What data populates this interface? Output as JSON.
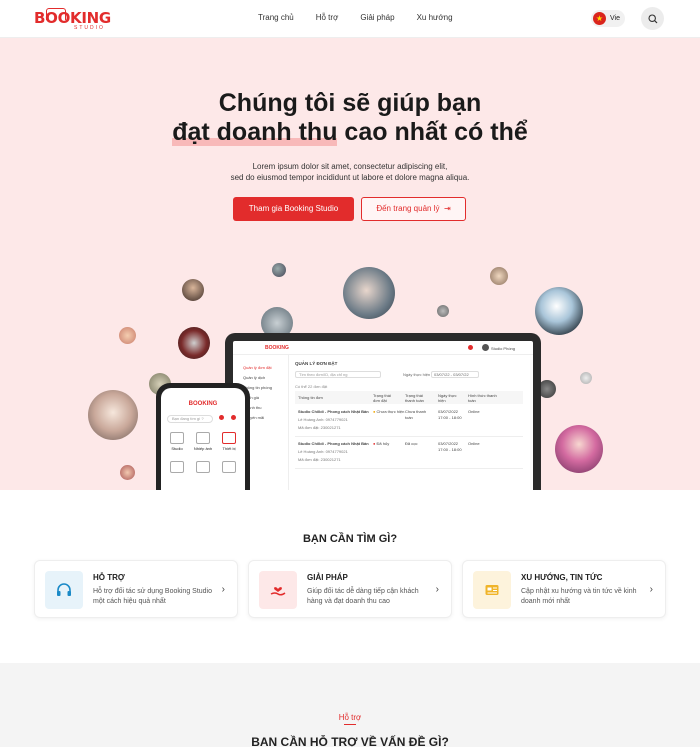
{
  "header": {
    "logo_text": "BOOKING",
    "logo_sub": "STUDIO",
    "nav": [
      "Trang chủ",
      "Hỗ trợ",
      "Giải pháp",
      "Xu hướng"
    ],
    "lang_label": "Vie"
  },
  "hero": {
    "title_line1": "Chúng tôi sẽ giúp bạn",
    "title_hl": "đạt doanh thu",
    "title_rest": " cao nhất có thể",
    "desc_line1": "Lorem ipsum dolor sit amet, consectetur adipiscing elit,",
    "desc_line2": "sed do eiusmod tempor incididunt ut labore et dolore magna aliqua.",
    "btn_primary": "Tham gia Booking Studio",
    "btn_outline": "Đến trang quản lý"
  },
  "laptop": {
    "logo": "BOOKING",
    "user": "Studio Phóng",
    "sidebar": [
      "Quản lý đơn đặt",
      "Quản lý dịch",
      "Thông tin phòng",
      "Đánh giá",
      "Doanh thu",
      "Khuyến mãi"
    ],
    "page_title": "QUẢN LÝ ĐƠN ĐẶT",
    "search_placeholder": "Tìm theo đơn/ID, địa chỉ ng",
    "date_label": "Ngày thực hiện",
    "date_value": "03/07/22 - 03/07/22",
    "count_label": "Có thể 22 đơn đặt",
    "columns": [
      "Thông tin đơn",
      "Trạng thái đơn đặt",
      "Trạng thái thanh toán",
      "Ngày thực hiện",
      "Hình thức thanh toán"
    ],
    "rows": [
      {
        "name": "Studio Chilldi - Phong cách Nhật Bản",
        "customer": "Lê Hoàng Anh: 0974779021",
        "id": "Mã đơn đặt: 230021271",
        "status": "Chưa thực hiện",
        "payment": "Chưa thanh toán",
        "date": "03/07/2022 17:00 - 18:00",
        "method": "Online"
      },
      {
        "name": "Studio Chilldi - Phong cách Nhật Bản",
        "customer": "Lê Hoàng Anh: 0974779021",
        "id": "Mã đơn đặt: 230021271",
        "status": "Đã hủy",
        "payment": "Đã cọc",
        "date": "03/07/2022 17:00 - 18:00",
        "method": "Online"
      }
    ]
  },
  "phone": {
    "logo": "BOOKING",
    "search_placeholder": "Bạn đang tìm gì ?",
    "categories": [
      "Studio",
      "Nhiếp ảnh",
      "Thiết bị"
    ]
  },
  "find": {
    "title": "BẠN CẦN TÌM GÌ?",
    "cards": [
      {
        "title": "HỖ TRỢ",
        "desc": "Hỗ trợ đối tác sử dụng Booking Studio một cách hiệu quả nhất"
      },
      {
        "title": "GIẢI PHÁP",
        "desc": "Giúp đối tác dễ dàng tiếp cận khách hàng và đạt doanh thu cao"
      },
      {
        "title": "XU HƯỚNG, TIN TỨC",
        "desc": "Cập nhật xu hướng và tin tức về kinh doanh mới nhất"
      }
    ]
  },
  "support": {
    "label": "Hỗ trợ",
    "title": "BẠN CẦN HỖ TRỢ VỀ VẤN ĐỀ GÌ?"
  },
  "colors": {
    "accent": "#e22c2c",
    "hero_bg": "#fde8e8"
  }
}
